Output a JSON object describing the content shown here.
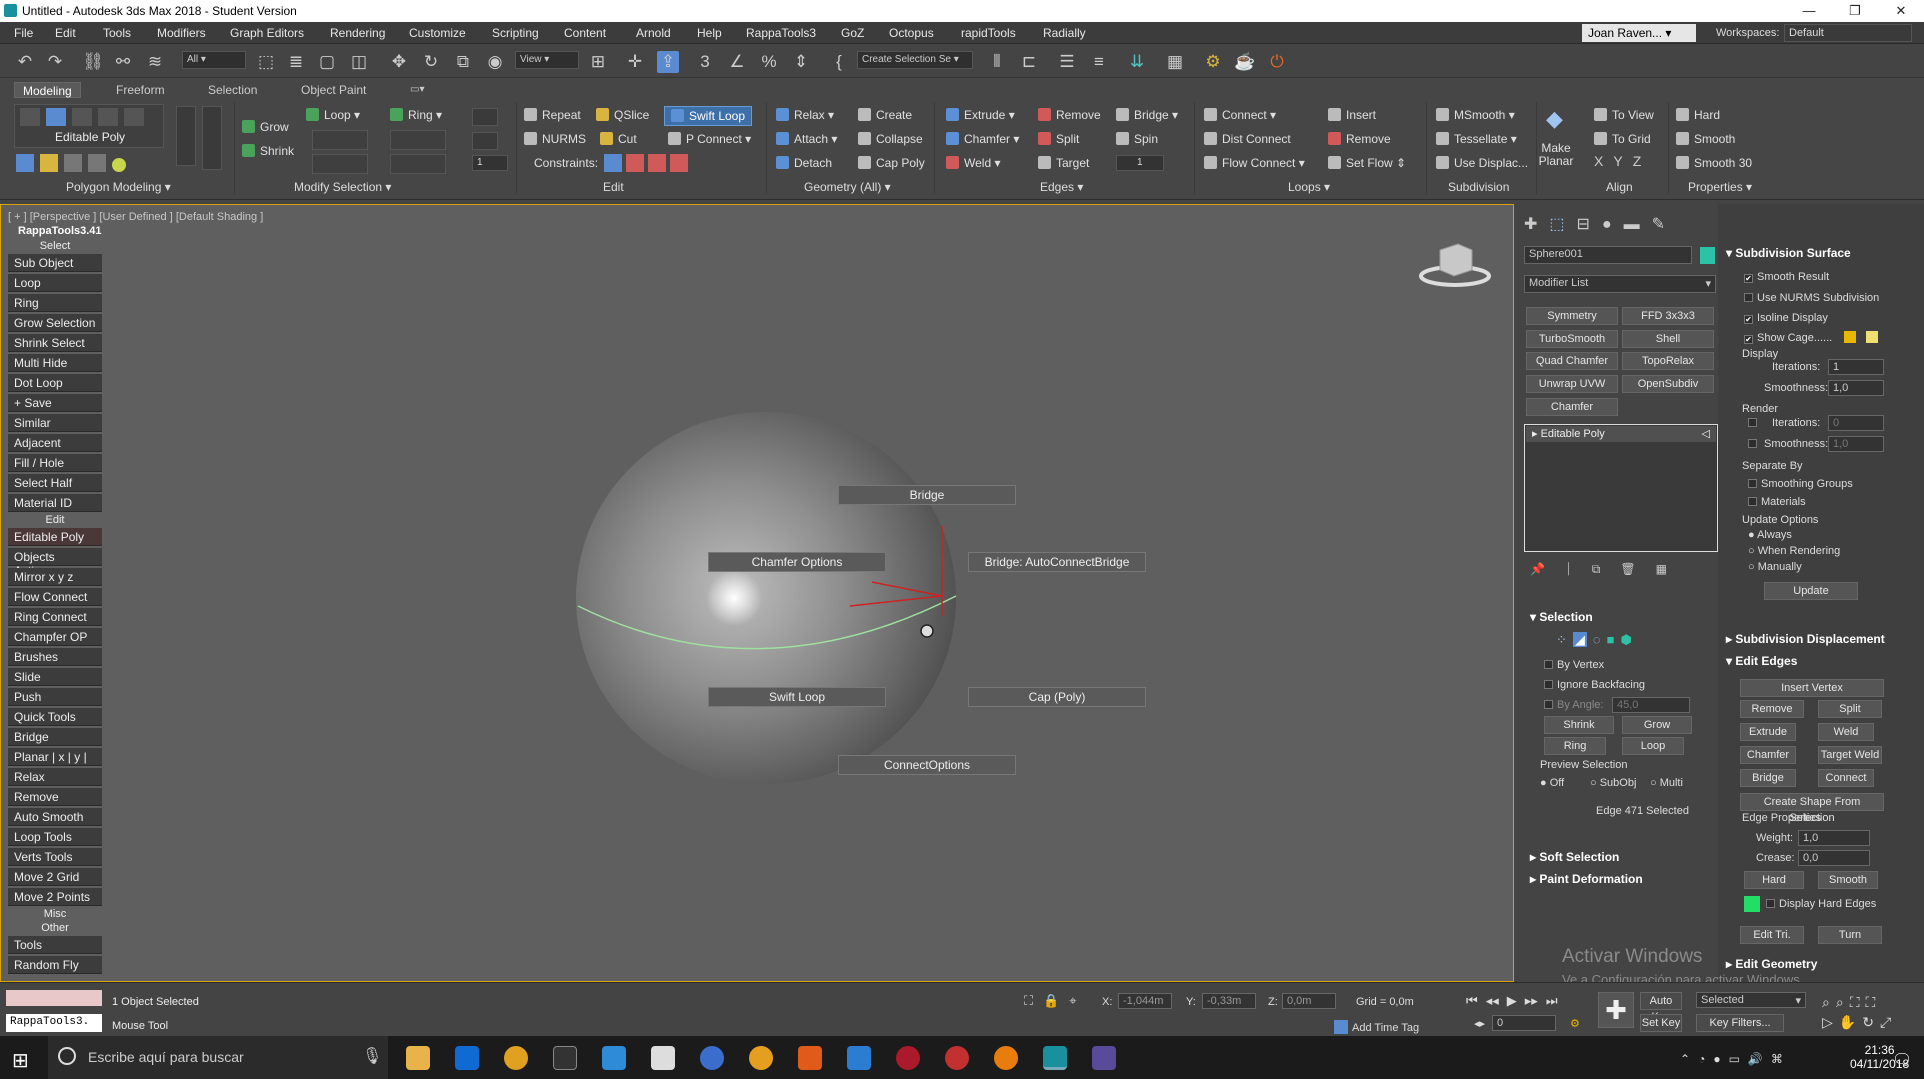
{
  "window": {
    "title": "Untitled - Autodesk 3ds Max 2018 - Student Version",
    "controls": [
      "—",
      "❐",
      "✕"
    ]
  },
  "menu": [
    "File",
    "Edit",
    "Tools",
    "Modifiers",
    "Graph Editors",
    "Rendering",
    "Customize",
    "Scripting",
    "Content",
    "Arnold",
    "Help",
    "RappaTools3",
    "GoZ",
    "Octopus",
    "rapidTools",
    "Radially"
  ],
  "user": {
    "name": "Joan Raven...",
    "workspaces_label": "Workspaces:",
    "workspace": "Default"
  },
  "toolbar": {
    "filter": "All",
    "view": "View",
    "selection_set": "Create Selection Se"
  },
  "ribbon": {
    "tabs": [
      "Modeling",
      "Freeform",
      "Selection",
      "Object Paint"
    ],
    "polygon_modeling": {
      "label": "Polygon Modeling",
      "editable_poly": "Editable Poly"
    },
    "modify_selection": {
      "label": "Modify Selection",
      "grow": "Grow",
      "shrink": "Shrink",
      "loop": "Loop",
      "ring": "Ring",
      "spinner": "1"
    },
    "edit": {
      "label": "Edit",
      "repeat": "Repeat",
      "nurms": "NURMS",
      "qslice": "QSlice",
      "cut": "Cut",
      "swift_loop": "Swift Loop",
      "p_connect": "P Connect",
      "constraints": "Constraints:"
    },
    "geometry": {
      "label": "Geometry (All)",
      "relax": "Relax",
      "attach": "Attach",
      "detach": "Detach",
      "create": "Create",
      "collapse": "Collapse",
      "cap_poly": "Cap Poly"
    },
    "edges": {
      "label": "Edges",
      "extrude": "Extrude",
      "chamfer": "Chamfer",
      "weld": "Weld",
      "remove": "Remove",
      "split": "Split",
      "target": "Target",
      "bridge": "Bridge",
      "spin": "Spin",
      "spin_value": "1"
    },
    "loops": {
      "label": "Loops",
      "connect": "Connect",
      "dist_connect": "Dist Connect",
      "flow_connect": "Flow Connect",
      "insert": "Insert",
      "remove": "Remove",
      "set_flow": "Set Flow"
    },
    "subdivision": {
      "label": "Subdivision",
      "msmooth": "MSmooth",
      "tessellate": "Tessellate",
      "use_displac": "Use Displac..."
    },
    "align": {
      "label": "Align",
      "make_planar": "Make Planar",
      "to_view": "To View",
      "to_grid": "To Grid",
      "x": "X",
      "y": "Y",
      "z": "Z"
    },
    "properties": {
      "label": "Properties",
      "hard": "Hard",
      "smooth": "Smooth",
      "smooth30": "Smooth 30"
    }
  },
  "viewport": {
    "label": "[ + ] [Perspective ] [User Defined ] [Default Shading ]",
    "quad": {
      "bridge": "Bridge",
      "chamfer_options": "Chamfer Options",
      "bridge_auto": "Bridge: AutoConnectBridge",
      "swift_loop": "Swift Loop",
      "cap_poly": "Cap (Poly)",
      "connect_options": "ConnectOptions"
    }
  },
  "rappa": {
    "title": "RappaTools3.41",
    "items": [
      {
        "t": "sect",
        "label": "Select"
      },
      {
        "t": "row",
        "label": "Sub Object"
      },
      {
        "t": "row",
        "label": "Loop"
      },
      {
        "t": "row",
        "label": "Ring"
      },
      {
        "t": "row",
        "label": "Grow Selection"
      },
      {
        "t": "row",
        "label": "Shrink Select"
      },
      {
        "t": "row",
        "label": "Multi Hide"
      },
      {
        "t": "row",
        "label": "Dot Loop"
      },
      {
        "t": "row",
        "label": "+ Save"
      },
      {
        "t": "row",
        "label": "Similar"
      },
      {
        "t": "row",
        "label": "Adjacent"
      },
      {
        "t": "row",
        "label": "Fill / Hole"
      },
      {
        "t": "row",
        "label": "Select Half"
      },
      {
        "t": "row",
        "label": "Material ID"
      },
      {
        "t": "sect",
        "label": "Edit"
      },
      {
        "t": "row",
        "label": "Editable Poly",
        "red": true
      },
      {
        "t": "row",
        "label": "Objects Actions"
      },
      {
        "t": "row",
        "label": "Mirror   x  y  z"
      },
      {
        "t": "row",
        "label": "Flow Connect"
      },
      {
        "t": "row",
        "label": "Ring Connect"
      },
      {
        "t": "row",
        "label": "Champfer OP"
      },
      {
        "t": "row",
        "label": "Brushes"
      },
      {
        "t": "row",
        "label": "Slide"
      },
      {
        "t": "row",
        "label": "Push"
      },
      {
        "t": "row",
        "label": "Quick Tools"
      },
      {
        "t": "row",
        "label": "Bridge"
      },
      {
        "t": "row",
        "label": "Planar | x | y | z"
      },
      {
        "t": "row",
        "label": "Relax"
      },
      {
        "t": "row",
        "label": "Remove"
      },
      {
        "t": "row",
        "label": "Auto Smooth"
      },
      {
        "t": "row",
        "label": "Loop Tools"
      },
      {
        "t": "row",
        "label": "Verts Tools"
      },
      {
        "t": "row",
        "label": "Move 2 Grid"
      },
      {
        "t": "row",
        "label": "Move 2 Points"
      },
      {
        "t": "sect",
        "label": "Misc"
      },
      {
        "t": "sect",
        "label": "Other"
      },
      {
        "t": "row",
        "label": "Tools"
      },
      {
        "t": "row",
        "label": "Random Fly"
      }
    ]
  },
  "command": {
    "object_name": "Sphere001",
    "modifier_list": "Modifier List",
    "modifiers": [
      "Symmetry",
      "FFD 3x3x3",
      "TurboSmooth",
      "Shell",
      "Quad Chamfer",
      "TopoRelax",
      "Unwrap UVW",
      "OpenSubdiv",
      "Chamfer"
    ],
    "stack_item": "Editable Poly",
    "selection": {
      "title": "Selection",
      "by_vertex": "By Vertex",
      "ignore_backfacing": "Ignore Backfacing",
      "by_angle": "By Angle:",
      "by_angle_value": "45,0",
      "shrink": "Shrink",
      "grow": "Grow",
      "ring": "Ring",
      "loop": "Loop",
      "preview": "Preview Selection",
      "off": "Off",
      "subobj": "SubObj",
      "multi": "Multi",
      "status": "Edge 471 Selected"
    },
    "soft_selection": "Soft Selection",
    "paint_deformation": "Paint Deformation"
  },
  "modifier_panel": {
    "subdiv_surface": "Subdivision Surface",
    "smooth_result": "Smooth Result",
    "use_nurms": "Use NURMS Subdivision",
    "isoline": "Isoline Display",
    "show_cage": "Show Cage......",
    "display": "Display",
    "iterations": "Iterations:",
    "iterations_val": "1",
    "smoothness": "Smoothness:",
    "smoothness_val": "1,0",
    "render": "Render",
    "r_iterations_val": "0",
    "r_smoothness_val": "1,0",
    "separate_by": "Separate By",
    "smoothing_groups": "Smoothing Groups",
    "materials": "Materials",
    "update_options": "Update Options",
    "always": "Always",
    "when_rendering": "When Rendering",
    "manually": "Manually",
    "update": "Update",
    "subdiv_displacement": "Subdivision Displacement",
    "edit_edges": "Edit Edges",
    "insert_vertex": "Insert Vertex",
    "remove": "Remove",
    "split": "Split",
    "extrude": "Extrude",
    "weld": "Weld",
    "chamfer": "Chamfer",
    "target_weld": "Target Weld",
    "bridge": "Bridge",
    "connect": "Connect",
    "create_shape": "Create Shape From Selection",
    "edge_properties": "Edge Properties",
    "weight": "Weight:",
    "weight_val": "1,0",
    "crease": "Crease:",
    "crease_val": "0,0",
    "hard": "Hard",
    "smooth": "Smooth",
    "display_hard_edges": "Display Hard Edges",
    "edit_tri": "Edit Tri.",
    "turn": "Turn",
    "edit_geometry": "Edit Geometry",
    "watermark1": "Activar Windows",
    "watermark2": "Ve a Configuración para activar Windows."
  },
  "status": {
    "script_label": "RappaTools3.",
    "selected": "1 Object Selected",
    "mouse_tool": "Mouse Tool",
    "x_label": "X:",
    "x_val": "-1,044m",
    "y_label": "Y:",
    "y_val": "-0,33m",
    "z_label": "Z:",
    "z_val": "0,0m",
    "grid": "Grid = 0,0m",
    "add_time_tag": "Add Time Tag",
    "auto_key": "Auto Key",
    "selected_drop": "Selected",
    "set_key": "Set Key",
    "key_filters": "Key Filters...",
    "frame": "0"
  },
  "taskbar": {
    "search": "Escribe aquí para buscar",
    "time": "21:36",
    "date": "04/11/2018"
  },
  "colors": {
    "accent": "#d9a400",
    "swift": "#3d6fa8",
    "object_color": "#2bc2a8"
  }
}
